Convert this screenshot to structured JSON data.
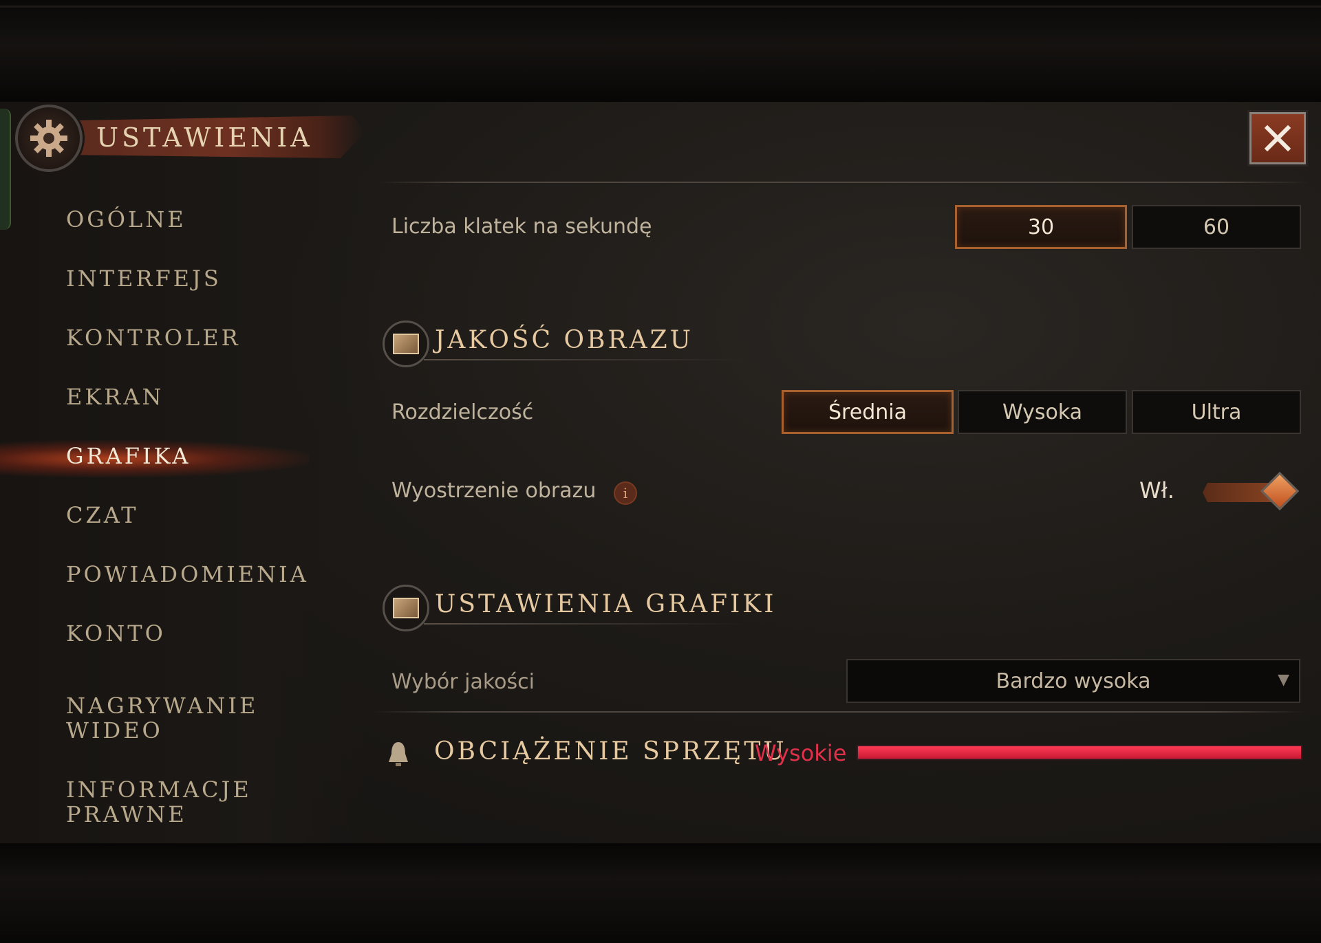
{
  "header": {
    "title": "USTAWIENIA"
  },
  "nav": {
    "items": [
      {
        "label": "OGÓLNE"
      },
      {
        "label": "INTERFEJS"
      },
      {
        "label": "KONTROLER"
      },
      {
        "label": "EKRAN"
      },
      {
        "label": "GRAFIKA",
        "active": true
      },
      {
        "label": "CZAT"
      },
      {
        "label": "POWIADOMIENIA"
      },
      {
        "label": "KONTO"
      },
      {
        "label_line1": "NAGRYWANIE",
        "label_line2": "WIDEO"
      },
      {
        "label_line1": "INFORMACJE",
        "label_line2": "PRAWNE"
      }
    ]
  },
  "fps": {
    "label": "Liczba klatek na sekundę",
    "options": [
      "30",
      "60"
    ],
    "selected": "30"
  },
  "image_quality": {
    "section_title": "JAKOŚĆ OBRAZU",
    "resolution": {
      "label": "Rozdzielczość",
      "options": [
        "Średnia",
        "Wysoka",
        "Ultra"
      ],
      "selected": "Średnia"
    },
    "sharpening": {
      "label": "Wyostrzenie obrazu",
      "info": "i",
      "state_label": "Wł.",
      "on": true
    }
  },
  "graphics_settings": {
    "section_title": "USTAWIENIA GRAFIKI",
    "quality": {
      "label": "Wybór jakości",
      "value": "Bardzo wysoka"
    }
  },
  "hardware_load": {
    "title": "OBCIĄŻENIE SPRZĘTU",
    "value": "Wysokie",
    "level": 1.0
  },
  "colors": {
    "accent": "#a8612e",
    "warning": "#e0304a",
    "active_glow": "#c8461e"
  },
  "icons": {
    "header": "gear-icon",
    "close": "close-icon",
    "section": "image-icon",
    "load": "bell-icon"
  }
}
